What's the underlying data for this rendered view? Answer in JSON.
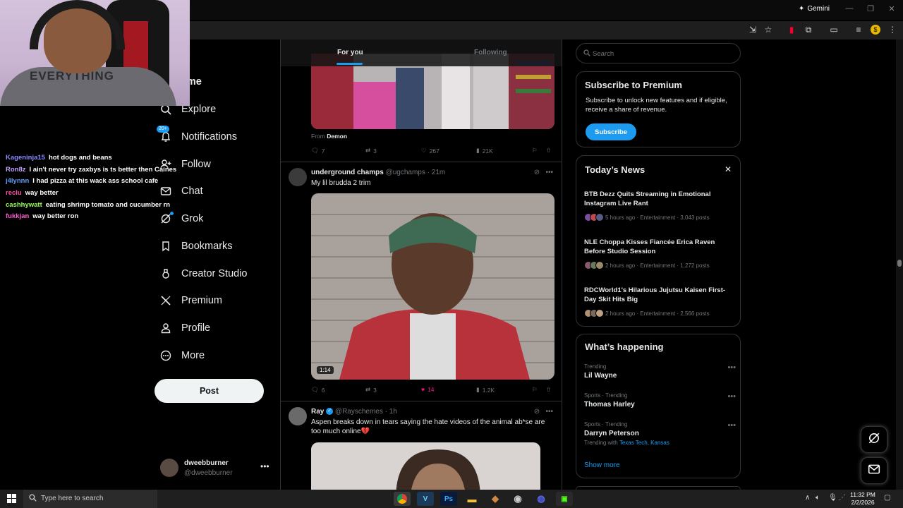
{
  "browser": {
    "gemini_label": "Gemini",
    "window_controls": [
      "—",
      "❐",
      "✕"
    ]
  },
  "stream": {
    "shirt_text": "EVERYTHING",
    "chat": [
      {
        "user": "Kageninja15",
        "color": "#8a8aff",
        "msg": "hot dogs and beans"
      },
      {
        "user": "Ron8z",
        "color": "#c0a0ff",
        "msg": "I ain't never try zaxbys is ts better then Caines"
      },
      {
        "user": "j4lynnn",
        "color": "#5aa0ff",
        "msg": "I had pizza at this wack ass school cafe"
      },
      {
        "user": "reclu",
        "color": "#ff4fa0",
        "msg": "way better"
      },
      {
        "user": "cashhywatt",
        "color": "#9aff5a",
        "msg": "eating shrimp tomato and cucumber rn"
      },
      {
        "user": "fukkjan",
        "color": "#ff5ad0",
        "msg": "way better ron"
      }
    ]
  },
  "nav": {
    "items": [
      {
        "label": "ome",
        "icon": "home-icon"
      },
      {
        "label": "Explore",
        "icon": "search-icon"
      },
      {
        "label": "Notifications",
        "icon": "bell-icon",
        "badge": "20+"
      },
      {
        "label": "Follow",
        "icon": "follow-icon"
      },
      {
        "label": "Chat",
        "icon": "mail-icon"
      },
      {
        "label": "Grok",
        "icon": "grok-icon"
      },
      {
        "label": "Bookmarks",
        "icon": "bookmark-icon"
      },
      {
        "label": "Creator Studio",
        "icon": "creator-studio-icon"
      },
      {
        "label": "Premium",
        "icon": "x-logo-icon"
      },
      {
        "label": "Profile",
        "icon": "person-icon"
      },
      {
        "label": "More",
        "icon": "more-circle-icon"
      }
    ],
    "post_label": "Post",
    "account": {
      "name": "dweebburner",
      "handle": "@dweebburner"
    }
  },
  "timeline": {
    "tabs": [
      "For you",
      "Following"
    ],
    "tweet0": {
      "from_prefix": "From",
      "from_name": "Demon",
      "replies": "7",
      "reposts": "3",
      "likes": "267",
      "views": "21K"
    },
    "tweet1": {
      "name": "underground champs",
      "handle": "@ugchamps",
      "time": "· 21m",
      "text": "My lil brudda 2 trim",
      "duration": "1:14",
      "replies": "6",
      "reposts": "3",
      "likes": "14",
      "views": "1.2K",
      "liked_color": "#f91880"
    },
    "tweet2": {
      "name": "Ray",
      "handle": "@Rayschemes",
      "time": "· 1h",
      "text": "Aspen breaks down in tears saying the hate videos of the animal ab*se are too much online💔"
    }
  },
  "sidebar": {
    "search_placeholder": "Search",
    "premium": {
      "title": "Subscribe to Premium",
      "desc": "Subscribe to unlock new features and if eligible, receive a share of revenue.",
      "button": "Subscribe"
    },
    "news": {
      "title": "Today’s News",
      "items": [
        {
          "title": "BTB Dezz Quits Streaming in Emotional Instagram Live Rant",
          "meta": "5 hours ago · Entertainment · 3,043 posts"
        },
        {
          "title": "NLE Choppa Kisses Fiancée Erica Raven Before Studio Session",
          "meta": "2 hours ago · Entertainment · 1,272 posts"
        },
        {
          "title": "RDCWorld1's Hilarious Jujutsu Kaisen First-Day Skit Hits Big",
          "meta": "2 hours ago · Entertainment · 2,566 posts"
        }
      ]
    },
    "happening": {
      "title": "What’s happening",
      "trends": [
        {
          "context": "Trending",
          "name": "Lil Wayne"
        },
        {
          "context": "Sports · Trending",
          "name": "Thomas Harley"
        },
        {
          "context": "Sports · Trending",
          "name": "Darryn Peterson",
          "with_prefix": "Trending with",
          "with_links": "Texas Tech, Kansas"
        }
      ],
      "show_more": "Show more"
    }
  },
  "taskbar": {
    "search_text": "Type here to search",
    "time": "11:32 PM",
    "date": "2/2/2026"
  },
  "colors": {
    "accent": "#1d9bf0",
    "like": "#f91880",
    "background": "#000000"
  }
}
